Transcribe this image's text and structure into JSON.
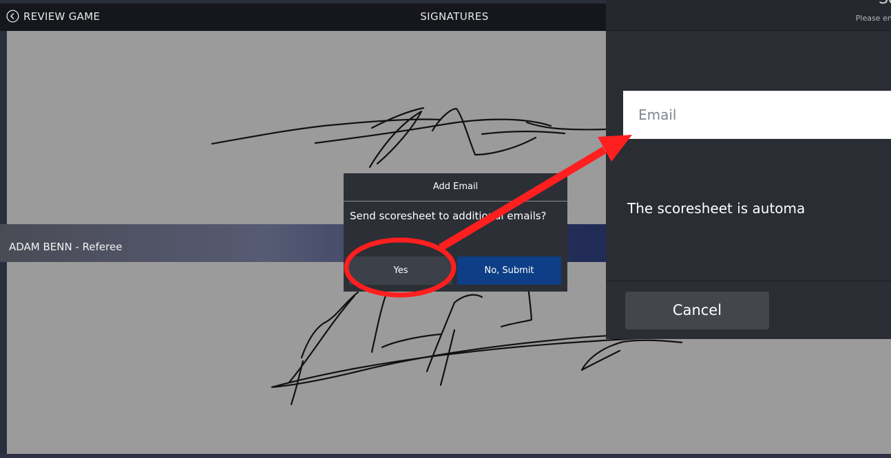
{
  "topbar": {
    "back_label": "REVIEW GAME",
    "title": "SIGNATURES"
  },
  "signature_section": {
    "referee_label": "ADAM BENN - Referee"
  },
  "dialog": {
    "title": "Add Email",
    "message": "Send scoresheet to additional emails?",
    "yes_label": "Yes",
    "no_label": "No, Submit"
  },
  "inset": {
    "heading_fragment": "Sc",
    "hint_fragment": "Please ent",
    "email_placeholder": "Email",
    "auto_text": "The scoresheet is automa",
    "cancel_label": "Cancel"
  },
  "colors": {
    "annotation": "#ff1f1f",
    "submit_button": "#0d3e86",
    "signature_pad": "#9b9b9b"
  }
}
